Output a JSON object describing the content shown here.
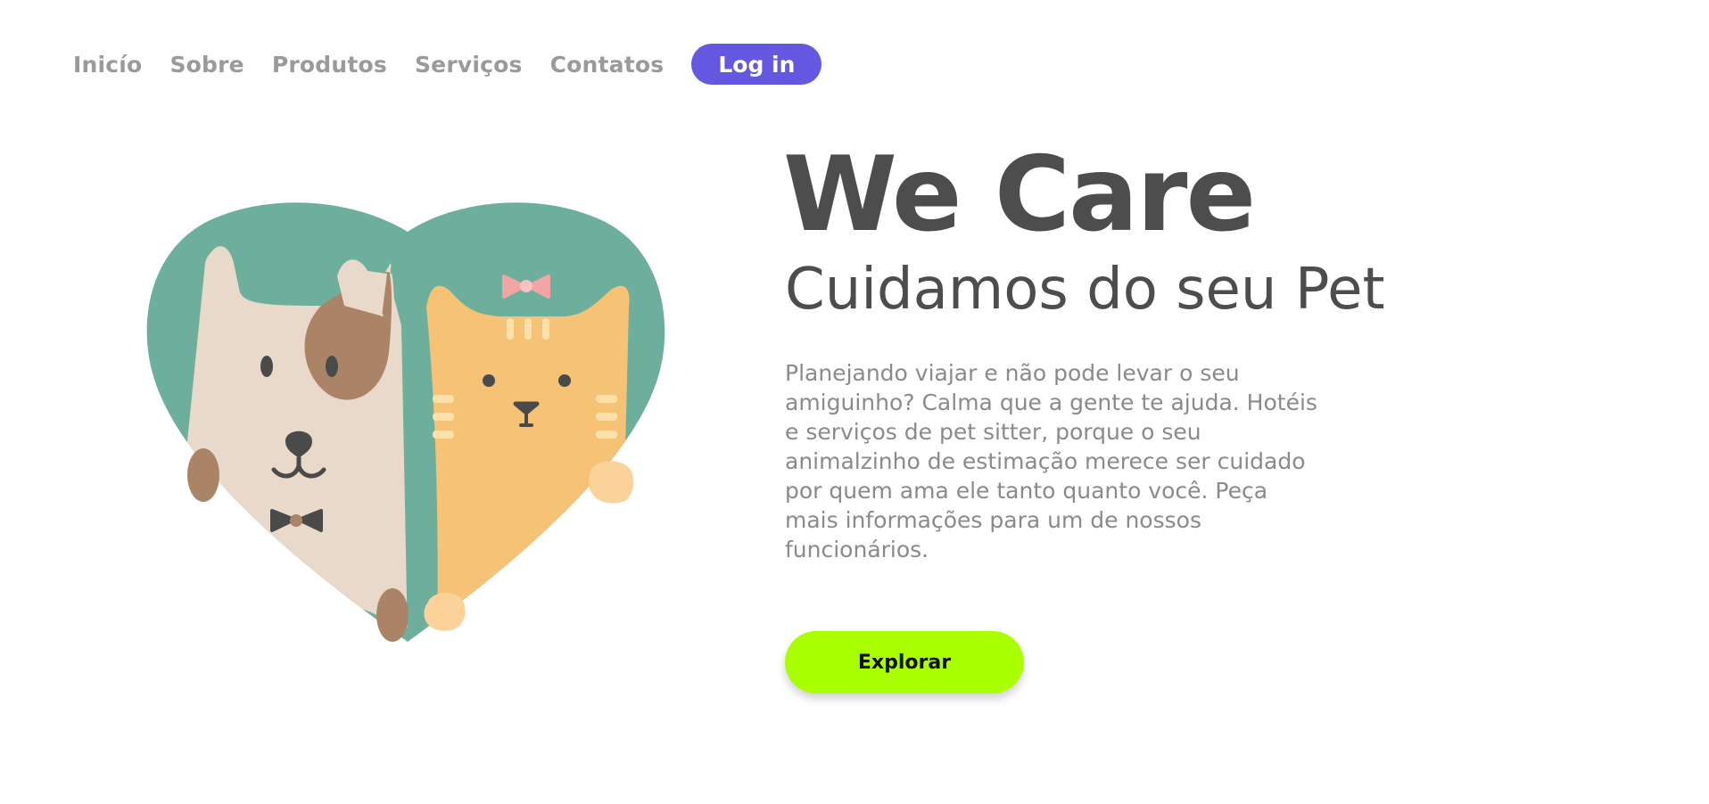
{
  "nav": {
    "links": [
      "Inicío",
      "Sobre",
      "Produtos",
      "Serviços",
      "Contatos"
    ],
    "login_label": "Log in"
  },
  "hero": {
    "title": "We Care",
    "subtitle": "Cuidamos do seu Pet",
    "description": "Planejando viajar e não pode levar o seu amiguinho? Calma que a gente te ajuda. Hotéis e serviços de pet sitter, porque o seu animalzinho de estimação merece ser cuidado por quem ama ele tanto quanto você. Peça mais informações para um de nossos funcionários.",
    "cta_label": "Explorar"
  },
  "colors": {
    "brand_purple": "#6558e0",
    "cta_green": "#a9ff00",
    "heart_teal": "#6daf9c",
    "dog_cream": "#e8d9cb",
    "dog_brown": "#ab8467",
    "cat_orange": "#f6c275",
    "text_dark": "#4d4d4d",
    "text_gray": "#8a8a8a"
  },
  "illustration": {
    "icon": "pets-heart-illustration"
  }
}
